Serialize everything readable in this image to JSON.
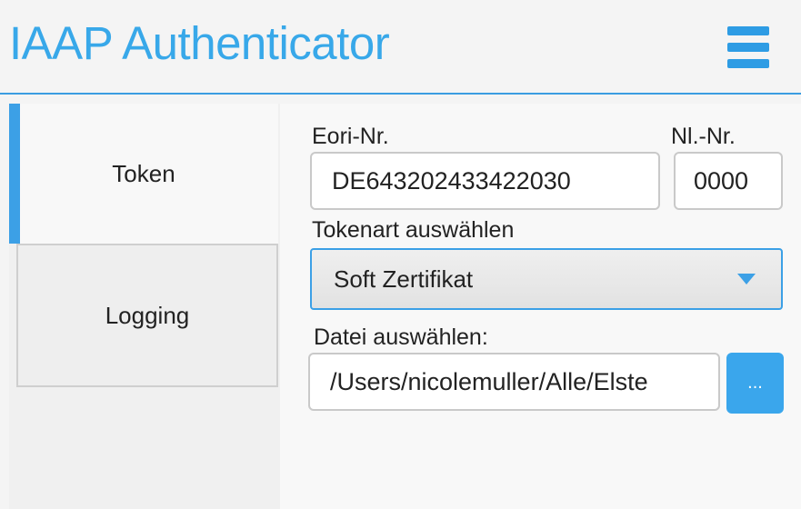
{
  "header": {
    "title": "IAAP Authenticator",
    "menu_icon": "hamburger-menu-icon"
  },
  "sidebar": {
    "tabs": [
      {
        "label": "Token",
        "active": true
      },
      {
        "label": "Logging",
        "active": false
      }
    ]
  },
  "form": {
    "eori_label": "Eori-Nr.",
    "eori_value": "DE643202433422030",
    "nl_label": "Nl.-Nr.",
    "nl_value": "0000",
    "tokenart_label": "Tokenart auswählen",
    "tokenart_value": "Soft Zertifikat",
    "datei_label": "Datei auswählen:",
    "datei_value": "/Users/nicolemuller/Alle/Elste",
    "browse_label": "..."
  },
  "colors": {
    "accent": "#3ca0e6",
    "title": "#38a8e9"
  }
}
